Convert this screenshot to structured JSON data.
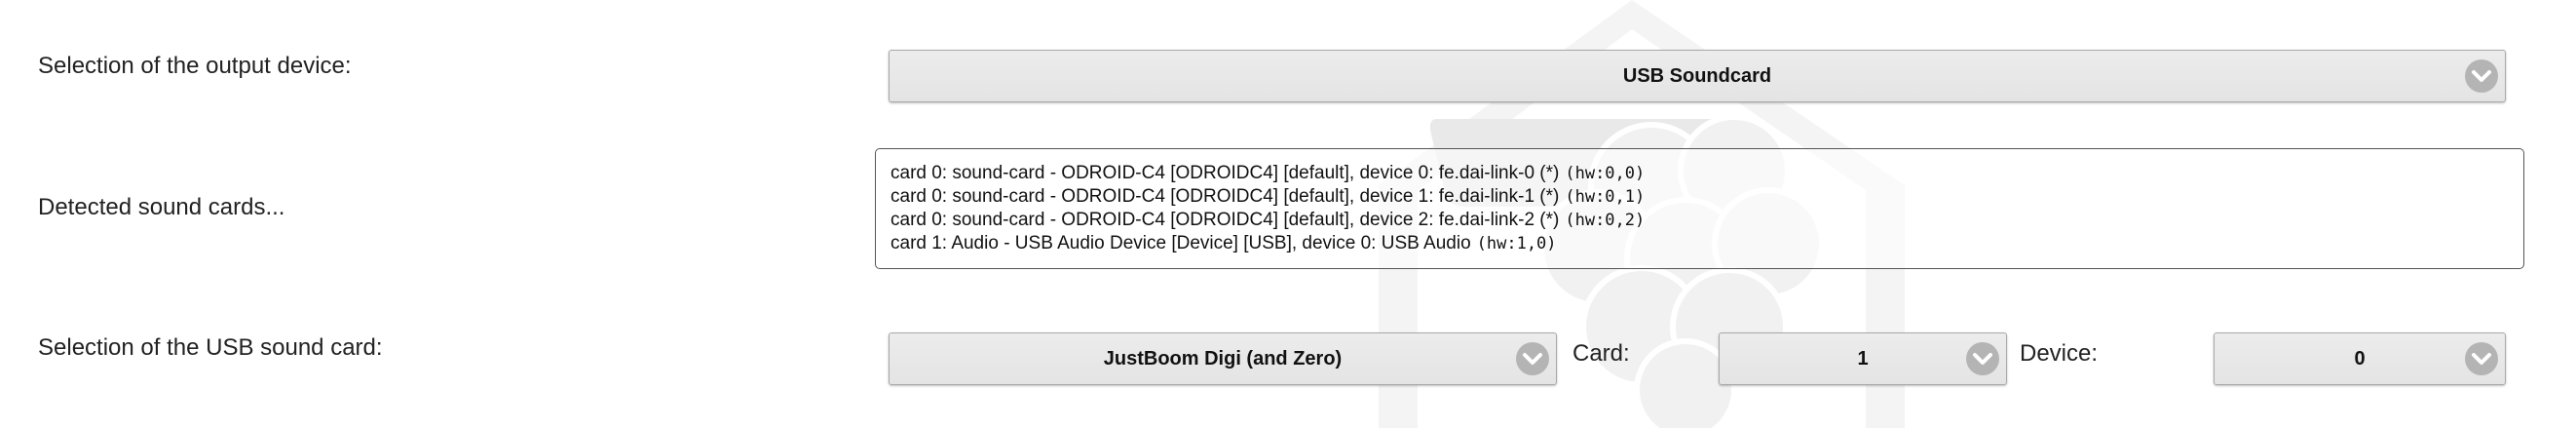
{
  "output_device": {
    "label": "Selection of the output device:",
    "selected": "USB Soundcard"
  },
  "detected": {
    "label": "Detected sound cards...",
    "cards": [
      {
        "text": "card 0: sound-card - ODROID-C4 [ODROIDC4] [default], device 0: fe.dai-link-0 (*)",
        "hw": "(hw:0,0)"
      },
      {
        "text": "card 0: sound-card - ODROID-C4 [ODROIDC4] [default], device 1: fe.dai-link-1 (*)",
        "hw": "(hw:0,1)"
      },
      {
        "text": "card 0: sound-card - ODROID-C4 [ODROIDC4] [default], device 2: fe.dai-link-2 (*)",
        "hw": "(hw:0,2)"
      },
      {
        "text": "card 1: Audio - USB Audio Device [Device] [USB], device 0: USB Audio",
        "hw": "(hw:1,0)"
      }
    ]
  },
  "usb_card": {
    "label": "Selection of the USB sound card:",
    "selected": "JustBoom Digi (and Zero)",
    "card_label": "Card:",
    "card_value": "1",
    "device_label": "Device:",
    "device_value": "0"
  },
  "icons": {
    "dropdown": "chevron-down-circle-icon",
    "watermark": "raspberry-house-watermark"
  },
  "colors": {
    "select_bg": "#e6e6e6",
    "chevron_circle": "#b4b4b4",
    "watermark": "#f3f3f3"
  }
}
